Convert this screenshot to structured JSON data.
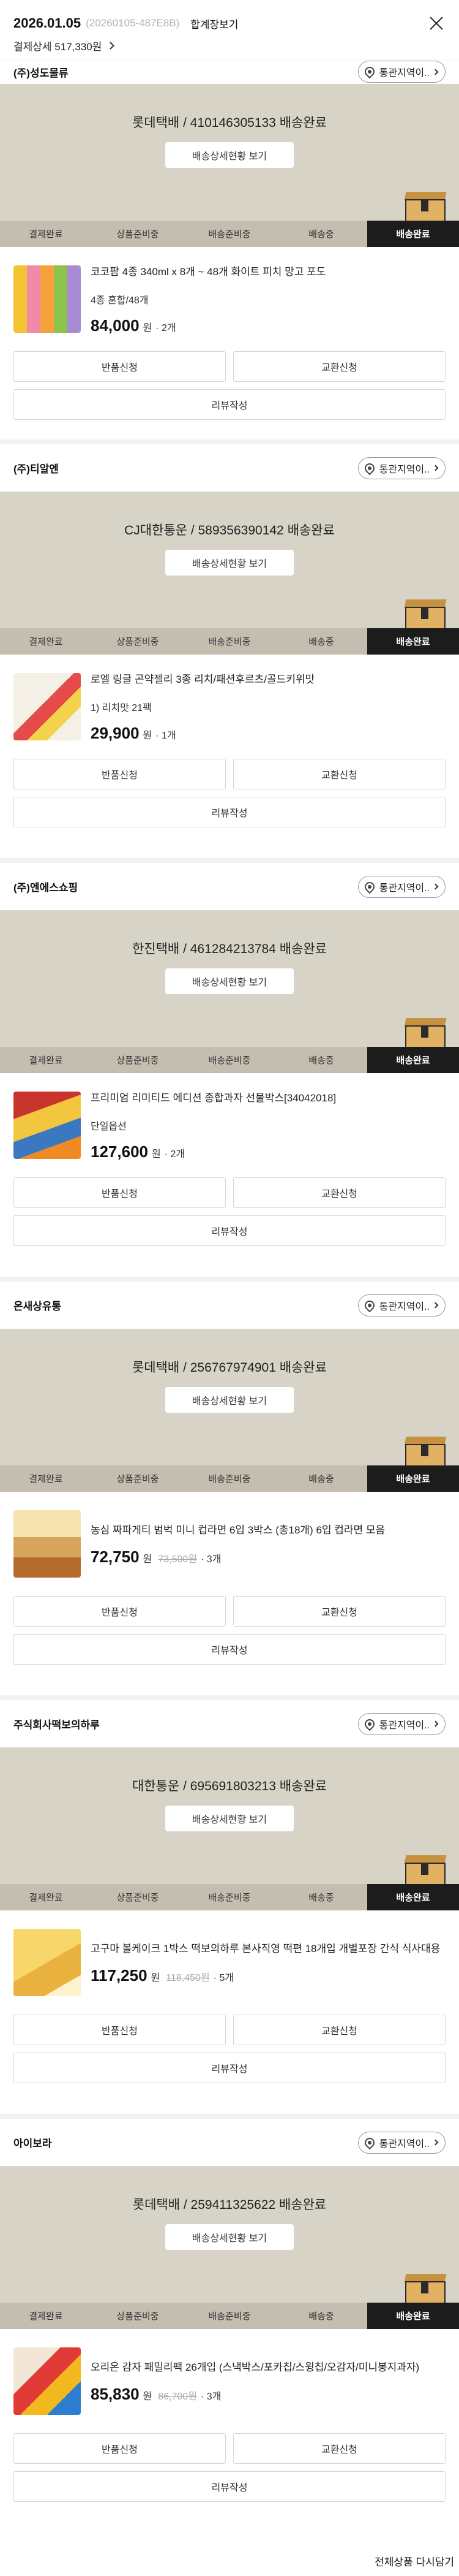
{
  "header": {
    "date": "2026.01.05",
    "order_no": "(20260105-487E8B)",
    "combined_link": "합계장보기",
    "payment_total": "결제상세 517,330원"
  },
  "labels": {
    "customs": "통관지역이..",
    "tracking_detail": "배송상세현황 보기",
    "return": "반품신청",
    "exchange": "교환신청",
    "review": "리뷰작성",
    "won": "원",
    "steps": [
      "결제완료",
      "상품준비중",
      "배송준비중",
      "배송중",
      "배송완료"
    ]
  },
  "sellers": [
    {
      "name": "(주)성도물류",
      "tracking": "롯데택배 / 410146305133 배송완료",
      "product": "코코팜 4종 340ml x 8개 ~ 48개 화이트 피치 망고 포도",
      "option": "4종 혼합/48개",
      "price": "84,000",
      "original_price": "",
      "qty": "· 2개",
      "has_customs": true
    },
    {
      "name": "(주)티알엔",
      "tracking": "CJ대한통운 / 589356390142 배송완료",
      "product": "로엘 링글 곤약젤리 3종 리치/패션후르츠/골드키위맛",
      "option": "1) 리치맛 21팩",
      "price": "29,900",
      "original_price": "",
      "qty": "· 1개",
      "has_customs": true
    },
    {
      "name": "(주)엔에스쇼핑",
      "tracking": "한진택배 / 461284213784 배송완료",
      "product": "프리미엄 리미티드 에디션 종합과자 선물박스[34042018]",
      "option": "단일옵션",
      "price": "127,600",
      "original_price": "",
      "qty": "· 2개",
      "has_customs": true
    },
    {
      "name": "온새상유통",
      "tracking": "롯데택배 / 256767974901 배송완료",
      "product": "농심 짜파게티 범벅 미니 컵라면 6입 3박스 (총18개) 6입 컵라면 모음",
      "option": "",
      "price": "72,750",
      "original_price": "73,500원",
      "qty": "· 3개",
      "has_customs": true
    },
    {
      "name": "주식회사떡보의하루",
      "tracking": "대한통운 / 695691803213 배송완료",
      "product": "고구마 볼케이크 1박스 떡보의하루 본사직영 떡편 18개입 개별포장 간식 식사대용",
      "option": "",
      "price": "117,250",
      "original_price": "118,450원",
      "qty": "· 5개",
      "has_customs": true
    },
    {
      "name": "아이보라",
      "tracking": "롯데택배 / 259411325622 배송완료",
      "product": "오리온 감자 패밀리팩 26개입 (스낵박스/포카칩/스윙칩/오감자/미니봉지과자)",
      "option": "",
      "price": "85,830",
      "original_price": "86,700원",
      "qty": "· 3개",
      "has_customs": true
    }
  ],
  "footer": {
    "reorder_all": "전체상품 다시담기"
  },
  "colors": {
    "panel_bg": "#d8d3c7",
    "status_bar": "#c4beb0",
    "active_step": "#1c1c1c"
  }
}
